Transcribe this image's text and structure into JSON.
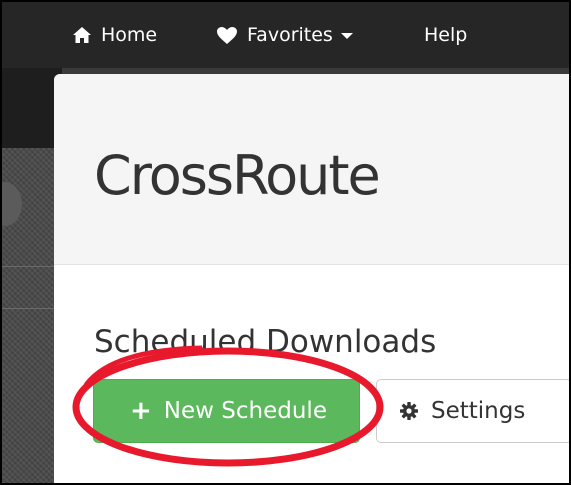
{
  "navbar": {
    "home_label": "Home",
    "favorites_label": "Favorites",
    "help_label": "Help"
  },
  "app": {
    "title": "CrossRoute"
  },
  "section": {
    "title": "Scheduled Downloads"
  },
  "buttons": {
    "new_schedule_label": "New Schedule",
    "settings_label": "Settings"
  },
  "icons": {
    "home": "home-icon",
    "favorites": "heart-icon",
    "new_schedule": "plus-icon",
    "settings": "gear-icon"
  },
  "colors": {
    "navbar_bg": "#262626",
    "success_green": "#5cb85c",
    "annotation_red": "#e8192c",
    "title_text": "#333333"
  }
}
